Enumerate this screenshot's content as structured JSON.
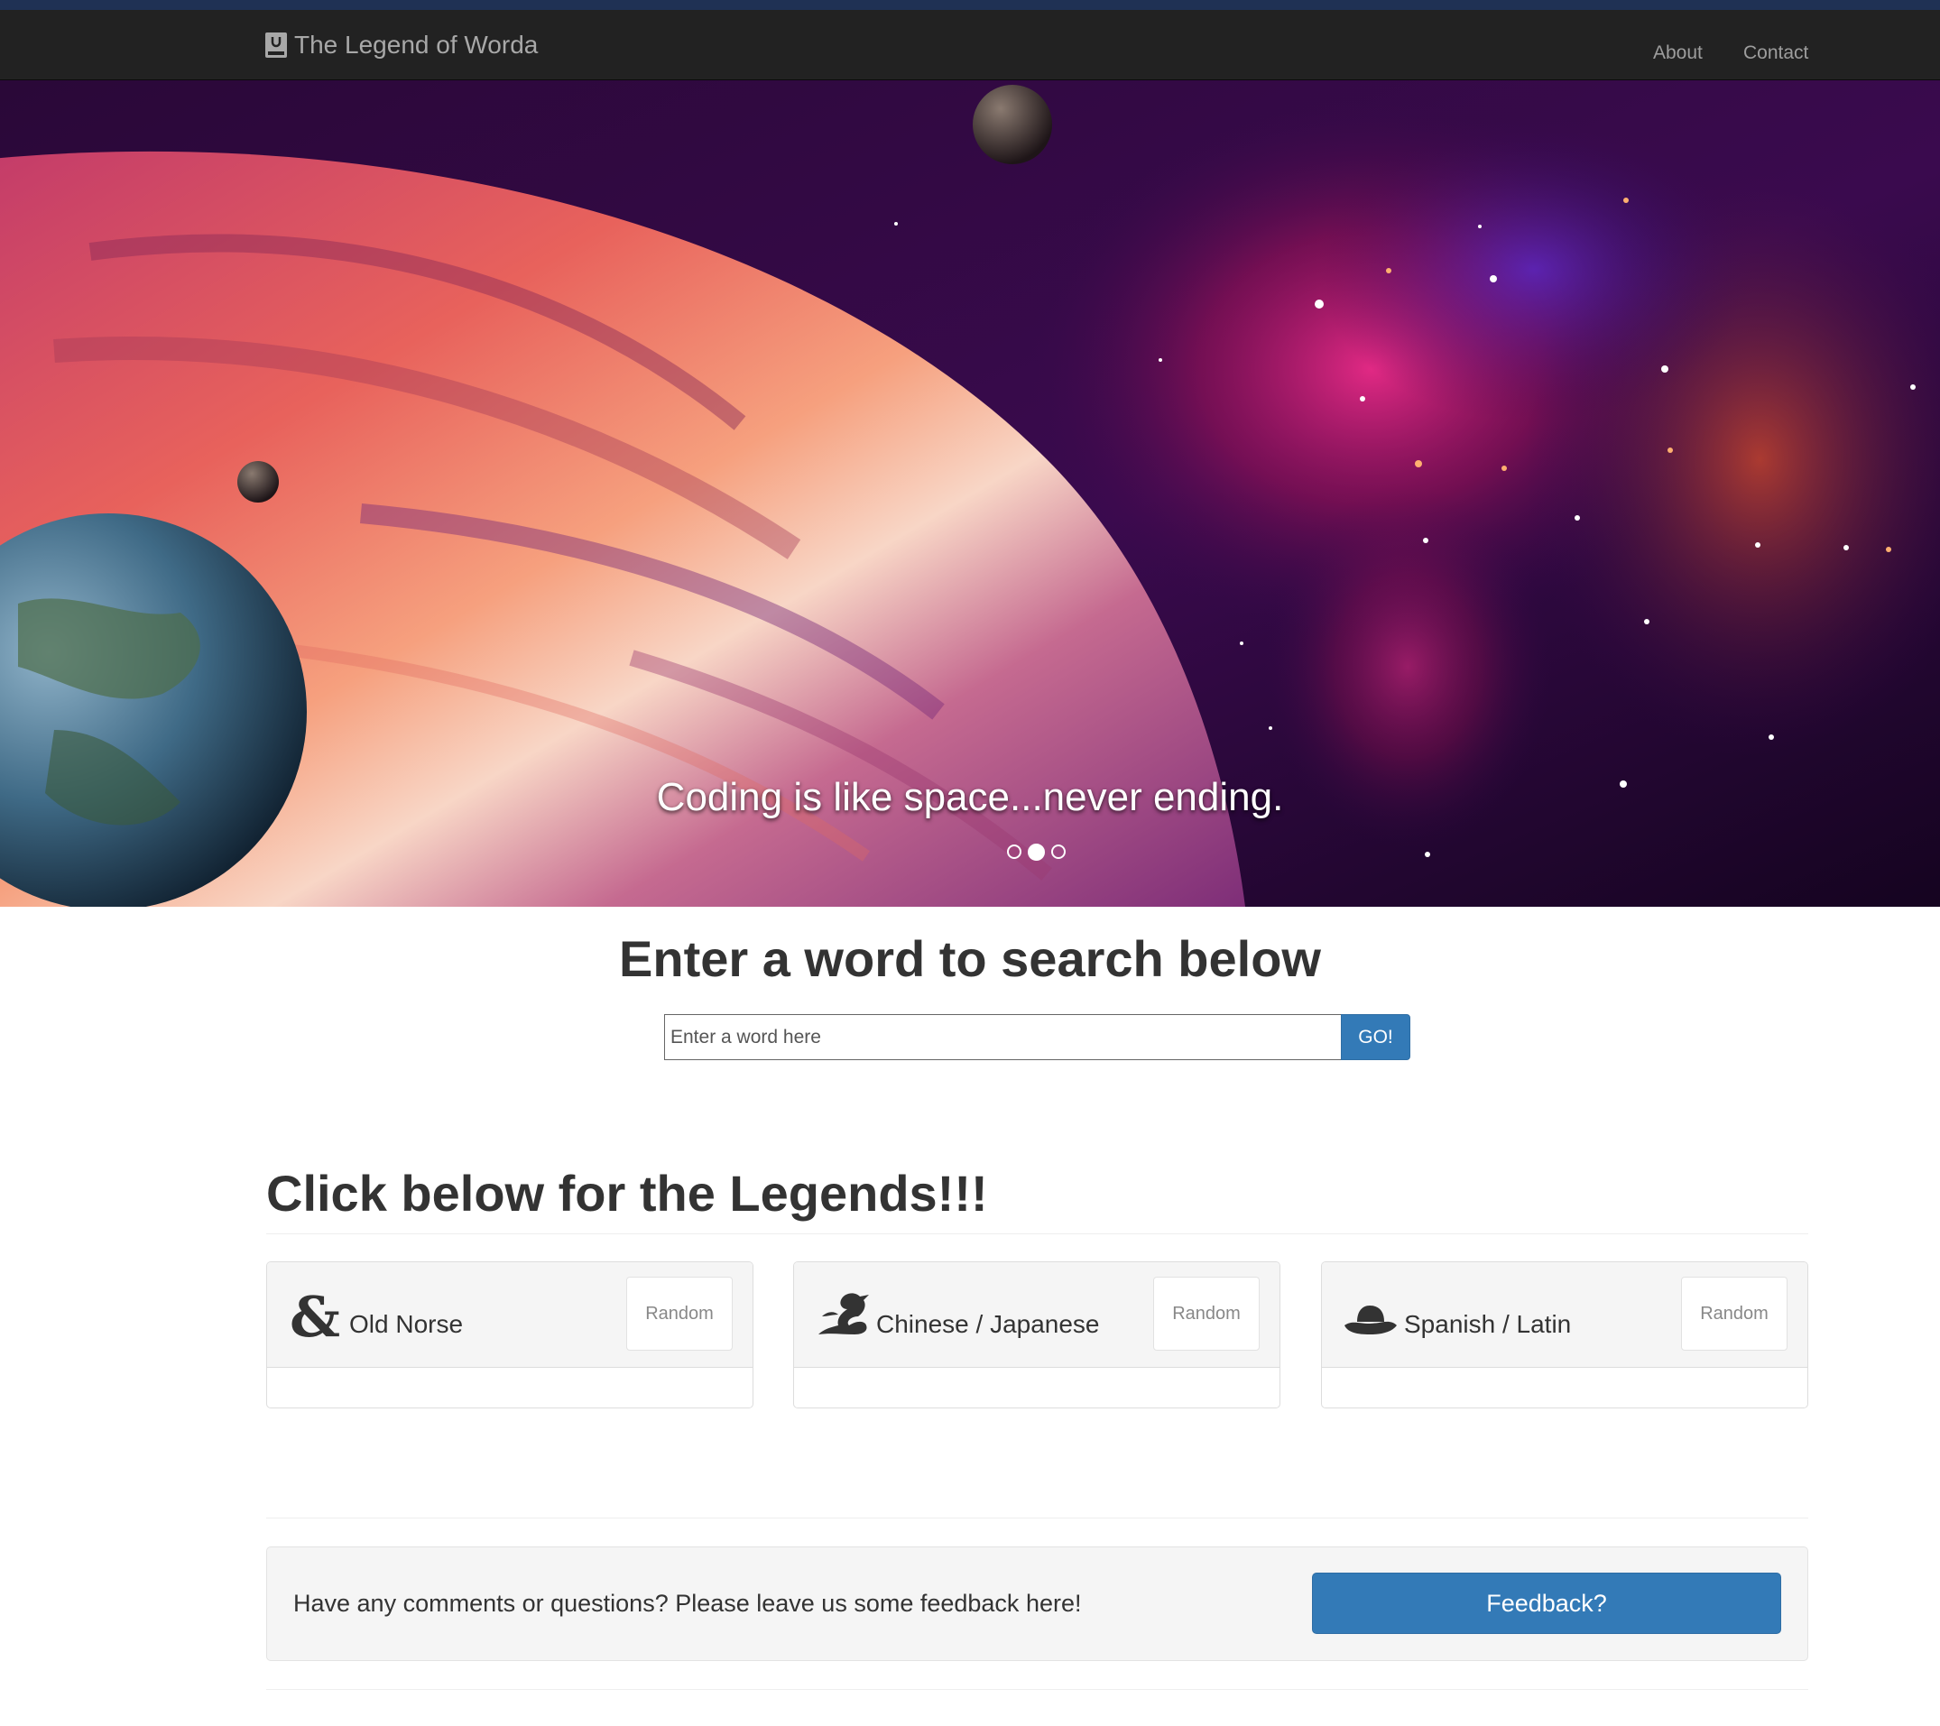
{
  "navbar": {
    "brand_icon": "book-icon",
    "brand_label": "The Legend of Worda",
    "links": [
      {
        "label": "About"
      },
      {
        "label": "Contact"
      }
    ]
  },
  "hero": {
    "caption": "Coding is like space...never ending.",
    "slide_count": 3,
    "active_slide": 2
  },
  "search": {
    "heading": "Enter a word to search below",
    "placeholder": "Enter a word here",
    "value": "",
    "button_label": "GO!"
  },
  "legends": {
    "heading": "Click below for the Legends!!!",
    "cards": [
      {
        "icon": "ampersand-rune-icon",
        "title": "Old Norse",
        "button_label": "Random"
      },
      {
        "icon": "dragon-icon",
        "title": "Chinese / Japanese",
        "button_label": "Random"
      },
      {
        "icon": "cowboy-hat-icon",
        "title": "Spanish / Latin",
        "button_label": "Random"
      }
    ]
  },
  "feedback": {
    "text": "Have any comments or questions? Please leave us some feedback here!",
    "button_label": "Feedback?"
  },
  "colors": {
    "navbar_bg": "#222222",
    "top_accent": "#1f3154",
    "primary_button": "#337ab7",
    "panel_heading_bg": "#f5f5f5",
    "text": "#333333"
  }
}
